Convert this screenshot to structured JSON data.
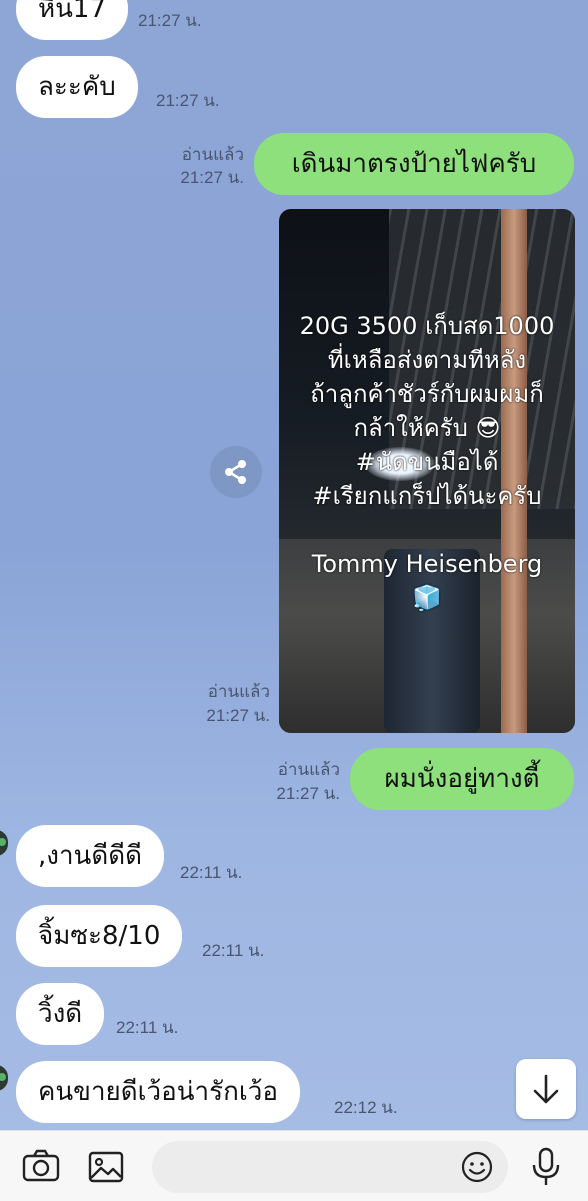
{
  "messages": [
    {
      "id": "m0",
      "side": "in",
      "text": "หิน17",
      "time": "21:27 น."
    },
    {
      "id": "m1",
      "side": "in",
      "text": "ละะคับ",
      "time": "21:27 น."
    },
    {
      "id": "m2",
      "side": "out",
      "text": "เดินมาตรงป้ายไฟครับ",
      "read": "อ่านแล้ว",
      "time": "21:27 น."
    },
    {
      "id": "m3",
      "side": "out",
      "type": "image",
      "read": "อ่านแล้ว",
      "time": "21:27 น.",
      "overlay_lines": [
        "20G 3500 เก็บสด1000",
        "ที่เหลือส่งตามทีหลัง",
        "ถ้าลูกค้าชัวร์กับผมผมก็",
        "กล้าให้ครับ 😎",
        "#นัดขนมือได้",
        "#เรียกแกร็ปได้นะครับ",
        "",
        "Tommy Heisenberg",
        "🧊"
      ]
    },
    {
      "id": "m4",
      "side": "out",
      "text": "ผมนั่งอยู่ทางตี้",
      "read": "อ่านแล้ว",
      "time": "21:27 น."
    },
    {
      "id": "m5",
      "side": "in",
      "text": ",งานดีดีดี",
      "time": "22:11 น."
    },
    {
      "id": "m6",
      "side": "in",
      "text": "จิ้มซะ8/10",
      "time": "22:11 น."
    },
    {
      "id": "m7",
      "side": "in",
      "text": "วิ้งดี",
      "time": "22:11 น."
    },
    {
      "id": "m8",
      "side": "in",
      "text": "คนขายดีเว้อน่ารักเว้อ",
      "time": "22:12 น."
    }
  ],
  "icons": {
    "share": "share-icon",
    "scroll_down": "arrow-down-icon",
    "camera": "camera-icon",
    "gallery": "image-icon",
    "emoji": "emoji-icon",
    "mic": "microphone-icon"
  },
  "colors": {
    "outgoing_bubble": "#8de07b",
    "incoming_bubble": "#ffffff",
    "chat_background": "#8ea6d6"
  }
}
